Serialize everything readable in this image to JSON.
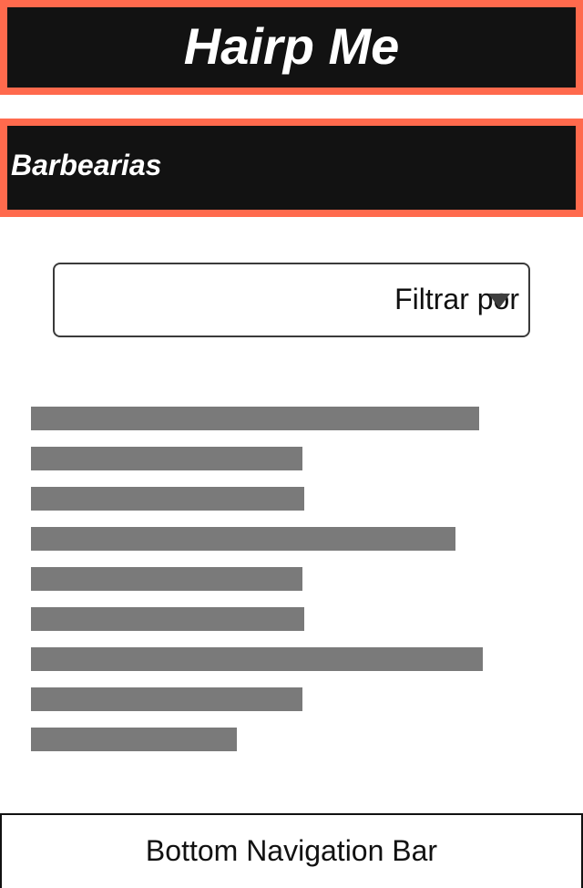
{
  "header": {
    "title": "Hairp Me"
  },
  "section": {
    "title": "Barbearias"
  },
  "filter": {
    "label": "Filtrar por"
  },
  "list": {
    "item_count": 9
  },
  "bottom_nav": {
    "label": "Bottom Navigation Bar"
  },
  "colors": {
    "accent": "#ff6a4d",
    "header_bg": "#121212",
    "placeholder": "#7a7a7a"
  },
  "icons": {
    "filter_dropdown": "chevron-down-icon"
  }
}
